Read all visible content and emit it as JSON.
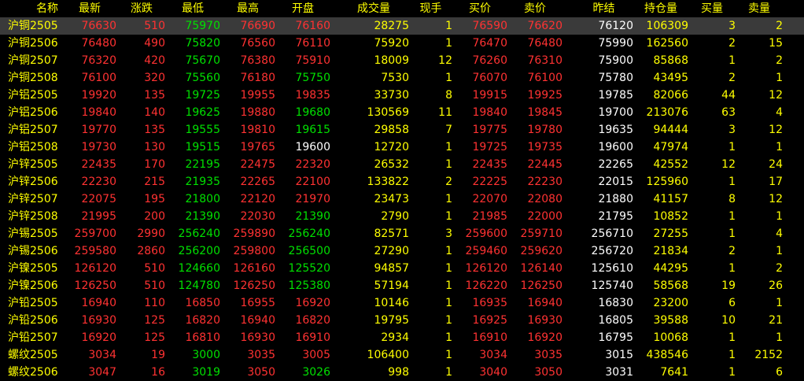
{
  "colors": {
    "up": "#ff3232",
    "down": "#00e000",
    "flat": "#ffffff",
    "label": "#ffff00",
    "selected_bg": "#3a3a3a"
  },
  "headers": [
    "名称",
    "最新",
    "涨跌",
    "最低",
    "最高",
    "开盘",
    "成交量",
    "现手",
    "买价",
    "卖价",
    "昨结",
    "持仓量",
    "买量",
    "卖量"
  ],
  "rows": [
    {
      "name": "沪铜2505",
      "latest": "76630",
      "change": "510",
      "low": "75970",
      "high": "76690",
      "open": "76160",
      "volume": "28275",
      "cur": "1",
      "bid": "76590",
      "ask": "76620",
      "prev": "76120",
      "oi": "106309",
      "bidvol": "3",
      "askvol": "2",
      "selected": true,
      "c": {
        "latest": "red",
        "change": "red",
        "low": "green",
        "high": "red",
        "open": "red",
        "bid": "red",
        "ask": "red"
      }
    },
    {
      "name": "沪铜2506",
      "latest": "76480",
      "change": "490",
      "low": "75820",
      "high": "76560",
      "open": "76110",
      "volume": "75920",
      "cur": "1",
      "bid": "76470",
      "ask": "76480",
      "prev": "75990",
      "oi": "162560",
      "bidvol": "2",
      "askvol": "15",
      "c": {
        "latest": "red",
        "change": "red",
        "low": "green",
        "high": "red",
        "open": "red",
        "bid": "red",
        "ask": "red"
      }
    },
    {
      "name": "沪铜2507",
      "latest": "76320",
      "change": "420",
      "low": "75670",
      "high": "76380",
      "open": "75910",
      "volume": "18009",
      "cur": "12",
      "bid": "76260",
      "ask": "76310",
      "prev": "75900",
      "oi": "85868",
      "bidvol": "1",
      "askvol": "2",
      "c": {
        "latest": "red",
        "change": "red",
        "low": "green",
        "high": "red",
        "open": "red",
        "bid": "red",
        "ask": "red"
      }
    },
    {
      "name": "沪铜2508",
      "latest": "76100",
      "change": "320",
      "low": "75560",
      "high": "76180",
      "open": "75750",
      "volume": "7530",
      "cur": "1",
      "bid": "76070",
      "ask": "76100",
      "prev": "75780",
      "oi": "43495",
      "bidvol": "2",
      "askvol": "1",
      "c": {
        "latest": "red",
        "change": "red",
        "low": "green",
        "high": "red",
        "open": "green",
        "bid": "red",
        "ask": "red"
      }
    },
    {
      "name": "沪铝2505",
      "latest": "19920",
      "change": "135",
      "low": "19725",
      "high": "19955",
      "open": "19835",
      "volume": "33730",
      "cur": "8",
      "bid": "19915",
      "ask": "19925",
      "prev": "19785",
      "oi": "82066",
      "bidvol": "44",
      "askvol": "12",
      "c": {
        "latest": "red",
        "change": "red",
        "low": "green",
        "high": "red",
        "open": "red",
        "bid": "red",
        "ask": "red"
      }
    },
    {
      "name": "沪铝2506",
      "latest": "19840",
      "change": "140",
      "low": "19625",
      "high": "19880",
      "open": "19680",
      "volume": "130569",
      "cur": "11",
      "bid": "19840",
      "ask": "19845",
      "prev": "19700",
      "oi": "213076",
      "bidvol": "63",
      "askvol": "4",
      "c": {
        "latest": "red",
        "change": "red",
        "low": "green",
        "high": "red",
        "open": "green",
        "bid": "red",
        "ask": "red"
      }
    },
    {
      "name": "沪铝2507",
      "latest": "19770",
      "change": "135",
      "low": "19555",
      "high": "19810",
      "open": "19615",
      "volume": "29858",
      "cur": "7",
      "bid": "19775",
      "ask": "19780",
      "prev": "19635",
      "oi": "94444",
      "bidvol": "3",
      "askvol": "12",
      "c": {
        "latest": "red",
        "change": "red",
        "low": "green",
        "high": "red",
        "open": "green",
        "bid": "red",
        "ask": "red"
      }
    },
    {
      "name": "沪铝2508",
      "latest": "19730",
      "change": "130",
      "low": "19515",
      "high": "19765",
      "open": "19600",
      "volume": "12720",
      "cur": "1",
      "bid": "19725",
      "ask": "19735",
      "prev": "19600",
      "oi": "47974",
      "bidvol": "1",
      "askvol": "1",
      "c": {
        "latest": "red",
        "change": "red",
        "low": "green",
        "high": "red",
        "open": "white",
        "bid": "red",
        "ask": "red"
      }
    },
    {
      "name": "沪锌2505",
      "latest": "22435",
      "change": "170",
      "low": "22195",
      "high": "22475",
      "open": "22320",
      "volume": "26532",
      "cur": "1",
      "bid": "22435",
      "ask": "22445",
      "prev": "22265",
      "oi": "42552",
      "bidvol": "12",
      "askvol": "24",
      "c": {
        "latest": "red",
        "change": "red",
        "low": "green",
        "high": "red",
        "open": "red",
        "bid": "red",
        "ask": "red"
      }
    },
    {
      "name": "沪锌2506",
      "latest": "22230",
      "change": "215",
      "low": "21935",
      "high": "22265",
      "open": "22100",
      "volume": "133822",
      "cur": "2",
      "bid": "22225",
      "ask": "22230",
      "prev": "22015",
      "oi": "125960",
      "bidvol": "1",
      "askvol": "17",
      "c": {
        "latest": "red",
        "change": "red",
        "low": "green",
        "high": "red",
        "open": "red",
        "bid": "red",
        "ask": "red"
      }
    },
    {
      "name": "沪锌2507",
      "latest": "22075",
      "change": "195",
      "low": "21800",
      "high": "22120",
      "open": "21970",
      "volume": "23473",
      "cur": "1",
      "bid": "22070",
      "ask": "22080",
      "prev": "21880",
      "oi": "41157",
      "bidvol": "8",
      "askvol": "12",
      "c": {
        "latest": "red",
        "change": "red",
        "low": "green",
        "high": "red",
        "open": "red",
        "bid": "red",
        "ask": "red"
      }
    },
    {
      "name": "沪锌2508",
      "latest": "21995",
      "change": "200",
      "low": "21390",
      "high": "22030",
      "open": "21390",
      "volume": "2790",
      "cur": "1",
      "bid": "21985",
      "ask": "22000",
      "prev": "21795",
      "oi": "10852",
      "bidvol": "1",
      "askvol": "1",
      "c": {
        "latest": "red",
        "change": "red",
        "low": "green",
        "high": "red",
        "open": "green",
        "bid": "red",
        "ask": "red"
      }
    },
    {
      "name": "沪锡2505",
      "latest": "259700",
      "change": "2990",
      "low": "256240",
      "high": "259890",
      "open": "256240",
      "volume": "82571",
      "cur": "3",
      "bid": "259600",
      "ask": "259710",
      "prev": "256710",
      "oi": "27255",
      "bidvol": "1",
      "askvol": "4",
      "c": {
        "latest": "red",
        "change": "red",
        "low": "green",
        "high": "red",
        "open": "green",
        "bid": "red",
        "ask": "red"
      }
    },
    {
      "name": "沪锡2506",
      "latest": "259580",
      "change": "2860",
      "low": "256200",
      "high": "259800",
      "open": "256500",
      "volume": "27290",
      "cur": "1",
      "bid": "259460",
      "ask": "259620",
      "prev": "256720",
      "oi": "21834",
      "bidvol": "2",
      "askvol": "1",
      "c": {
        "latest": "red",
        "change": "red",
        "low": "green",
        "high": "red",
        "open": "green",
        "bid": "red",
        "ask": "red"
      }
    },
    {
      "name": "沪镍2505",
      "latest": "126120",
      "change": "510",
      "low": "124660",
      "high": "126160",
      "open": "125520",
      "volume": "94857",
      "cur": "1",
      "bid": "126120",
      "ask": "126140",
      "prev": "125610",
      "oi": "44295",
      "bidvol": "1",
      "askvol": "2",
      "c": {
        "latest": "red",
        "change": "red",
        "low": "green",
        "high": "red",
        "open": "green",
        "bid": "red",
        "ask": "red"
      }
    },
    {
      "name": "沪镍2506",
      "latest": "126250",
      "change": "510",
      "low": "124780",
      "high": "126250",
      "open": "125380",
      "volume": "57194",
      "cur": "1",
      "bid": "126220",
      "ask": "126250",
      "prev": "125740",
      "oi": "58568",
      "bidvol": "19",
      "askvol": "26",
      "c": {
        "latest": "red",
        "change": "red",
        "low": "green",
        "high": "red",
        "open": "green",
        "bid": "red",
        "ask": "red"
      }
    },
    {
      "name": "沪铅2505",
      "latest": "16940",
      "change": "110",
      "low": "16850",
      "high": "16955",
      "open": "16920",
      "volume": "10146",
      "cur": "1",
      "bid": "16935",
      "ask": "16940",
      "prev": "16830",
      "oi": "23200",
      "bidvol": "6",
      "askvol": "1",
      "c": {
        "latest": "red",
        "change": "red",
        "low": "red",
        "high": "red",
        "open": "red",
        "bid": "red",
        "ask": "red"
      }
    },
    {
      "name": "沪铅2506",
      "latest": "16930",
      "change": "125",
      "low": "16820",
      "high": "16940",
      "open": "16820",
      "volume": "19795",
      "cur": "1",
      "bid": "16925",
      "ask": "16930",
      "prev": "16805",
      "oi": "39588",
      "bidvol": "10",
      "askvol": "21",
      "c": {
        "latest": "red",
        "change": "red",
        "low": "red",
        "high": "red",
        "open": "red",
        "bid": "red",
        "ask": "red"
      }
    },
    {
      "name": "沪铅2507",
      "latest": "16920",
      "change": "125",
      "low": "16810",
      "high": "16930",
      "open": "16910",
      "volume": "2934",
      "cur": "1",
      "bid": "16910",
      "ask": "16920",
      "prev": "16795",
      "oi": "10068",
      "bidvol": "1",
      "askvol": "1",
      "c": {
        "latest": "red",
        "change": "red",
        "low": "red",
        "high": "red",
        "open": "red",
        "bid": "red",
        "ask": "red"
      }
    },
    {
      "name": "螺纹2505",
      "latest": "3034",
      "change": "19",
      "low": "3000",
      "high": "3035",
      "open": "3005",
      "volume": "106400",
      "cur": "1",
      "bid": "3034",
      "ask": "3035",
      "prev": "3015",
      "oi": "438546",
      "bidvol": "1",
      "askvol": "2152",
      "c": {
        "latest": "red",
        "change": "red",
        "low": "green",
        "high": "red",
        "open": "red",
        "bid": "red",
        "ask": "red"
      }
    },
    {
      "name": "螺纹2506",
      "latest": "3047",
      "change": "16",
      "low": "3019",
      "high": "3050",
      "open": "3026",
      "volume": "998",
      "cur": "1",
      "bid": "3040",
      "ask": "3050",
      "prev": "3031",
      "oi": "7641",
      "bidvol": "1",
      "askvol": "6",
      "c": {
        "latest": "red",
        "change": "red",
        "low": "green",
        "high": "red",
        "open": "green",
        "bid": "red",
        "ask": "red"
      }
    }
  ]
}
